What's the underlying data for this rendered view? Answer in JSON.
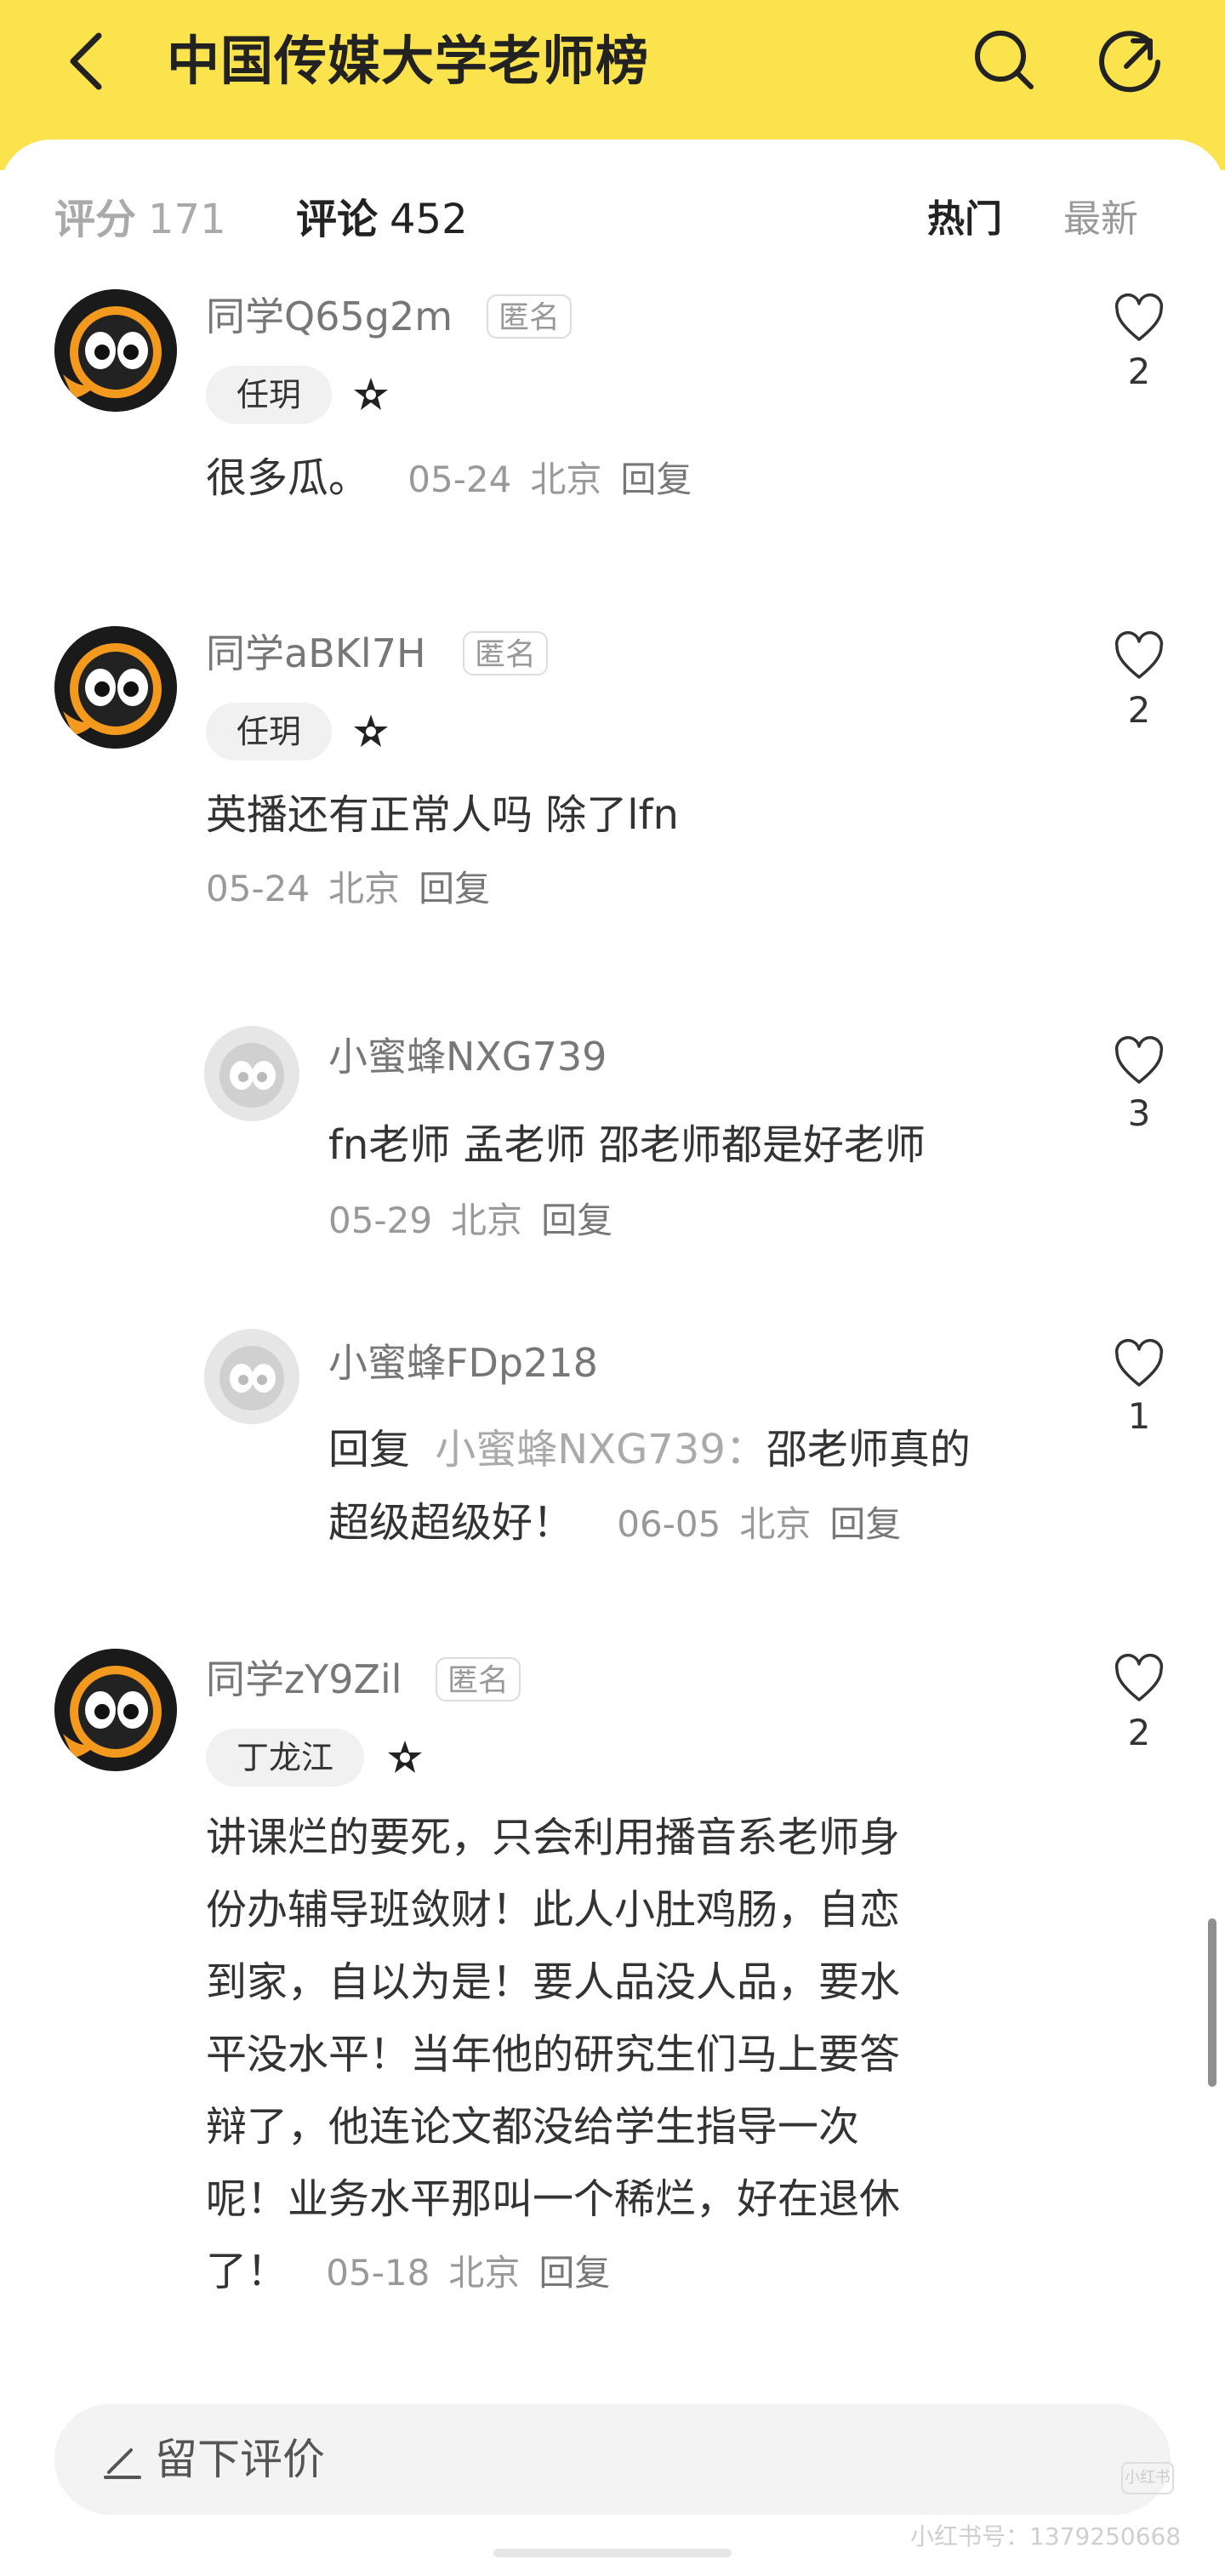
{
  "header": {
    "title": "中国传媒大学老师榜",
    "bg_color": "#fbe34e",
    "back_icon": "chevron-left-icon",
    "search_icon": "search-icon",
    "share_icon": "share-icon"
  },
  "tabs": {
    "rating_label": "评分",
    "rating_count": "171",
    "comments_label": "评论",
    "comments_count": "452",
    "sort_hot": "热门",
    "sort_new": "最新"
  },
  "comments": [
    {
      "user": "同学Q65g2m",
      "anon": "匿名",
      "teacher": "任玥",
      "text": "很多瓜。",
      "date": "05-24",
      "location": "北京",
      "reply": "回复",
      "likes": "2"
    },
    {
      "user": "同学aBKl7H",
      "anon": "匿名",
      "teacher": "任玥",
      "text": "英播还有正常人吗 除了lfn",
      "date": "05-24",
      "location": "北京",
      "reply": "回复",
      "likes": "2",
      "replies": [
        {
          "user": "小蜜蜂NXG739",
          "text": "fn老师 孟老师 邵老师都是好老师",
          "date": "05-29",
          "location": "北京",
          "reply": "回复",
          "likes": "3"
        },
        {
          "user": "小蜜蜂FDp218",
          "prefix": "回复",
          "ref_user": "小蜜蜂NXG739：",
          "text_line1": "邵老师真的",
          "text_line2": "超级超级好！",
          "date": "06-05",
          "location": "北京",
          "reply": "回复",
          "likes": "1"
        }
      ]
    },
    {
      "user": "同学zY9Zil",
      "anon": "匿名",
      "teacher": "丁龙江",
      "lines": [
        "讲课烂的要死，只会利用播音系老师身",
        "份办辅导班敛财！此人小肚鸡肠，自恋",
        "到家，自以为是！要人品没人品，要水",
        "平没水平！当年他的研究生们马上要答",
        "辩了，他连论文都没给学生指导一次",
        "呢！业务水平那叫一个稀烂，好在退休",
        "了！"
      ],
      "date": "05-18",
      "location": "北京",
      "reply": "回复",
      "likes": "2"
    }
  ],
  "input": {
    "placeholder": "留下评价"
  },
  "watermark": {
    "text": "小红书号：1379250668",
    "logo": "小红书"
  }
}
